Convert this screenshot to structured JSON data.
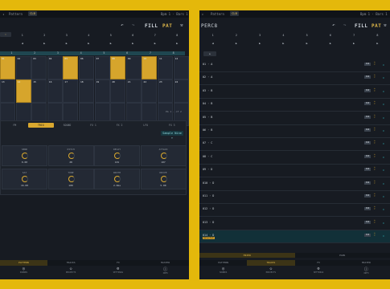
{
  "left": {
    "topbar": {
      "left_text": "Pattern",
      "chip": "CLB",
      "right_text": "Bpm 1 · Bars 1"
    },
    "header": {
      "fill": "FILL",
      "pat": "PAT",
      "undo_icon": "undo-icon",
      "redo_icon": "redo-icon",
      "wrench_icon": "wrench-icon"
    },
    "controls_row1": [
      "1",
      "2",
      "3",
      "4",
      "5",
      "6",
      "7",
      "8"
    ],
    "controls_row2": [
      "◀",
      "▶",
      "▶",
      "▶",
      "▶",
      "▶",
      "▶",
      "▶"
    ],
    "step_header": [
      "1",
      "2",
      "3",
      "4",
      "5",
      "6",
      "7",
      "8"
    ],
    "pad_labels": [
      "01",
      "02",
      "03",
      "04",
      "05",
      "06",
      "07",
      "08",
      "09",
      "10",
      "11",
      "12",
      "13",
      "14",
      "15",
      "16",
      "17",
      "18",
      "19",
      "20",
      "21",
      "22",
      "23",
      "24"
    ],
    "pads_on": [
      0,
      4,
      7,
      9,
      13
    ],
    "page_indicator": "PG 1 · of 2",
    "tabs": [
      "FM",
      "TRIG",
      "SOUND",
      "FX 1",
      "FX 2",
      "LFO",
      "FX 3"
    ],
    "active_tab": 1,
    "preset_button": "Sample Nine ▾",
    "knobs": [
      {
        "label": "SEND",
        "value": "0.00"
      },
      {
        "label": "PITCH",
        "value": "28"
      },
      {
        "label": "DECAY",
        "value": "101"
      },
      {
        "label": "ATTACK",
        "value": "107"
      },
      {
        "label": "SAT",
        "value": "16.00"
      },
      {
        "label": "TONE",
        "value": "100"
      },
      {
        "label": "WIDTH",
        "value": "2.0ms"
      },
      {
        "label": "DRIVE",
        "value": "5.00"
      }
    ],
    "bottom_tabs": [
      "PATTERN",
      "TRACKS",
      "FX",
      "MASTER"
    ],
    "bottom_active": 0,
    "nav": [
      {
        "icon": "◎",
        "label": "SOUNDS"
      },
      {
        "icon": "◇",
        "label": "PROJECTS"
      },
      {
        "icon": "⚙",
        "label": "SETTINGS"
      },
      {
        "icon": "ⓘ",
        "label": "INFO"
      }
    ]
  },
  "right": {
    "topbar": {
      "left_text": "Pattern",
      "chip": "CLB",
      "right_text": "Bpm 1 · Bars 1"
    },
    "title": "PERC8",
    "header": {
      "fill": "FILL",
      "pat": "PAT",
      "undo_icon": "undo-icon",
      "redo_icon": "redo-icon",
      "wrench_icon": "wrench-icon"
    },
    "controls_row1": [
      "1",
      "2",
      "3",
      "4",
      "5",
      "6",
      "7",
      "8"
    ],
    "controls_row2": [
      "◀",
      "▶",
      "▶",
      "▶",
      "▶",
      "▶",
      "▶",
      "▶"
    ],
    "add_button": "+",
    "tracks": [
      {
        "label": "01 · A",
        "badge": "PAN",
        "sub": ""
      },
      {
        "label": "02 · A",
        "badge": "PAN",
        "sub": ""
      },
      {
        "label": "03 · B",
        "badge": "PAN",
        "sub": ""
      },
      {
        "label": "04 · B",
        "badge": "PAN",
        "sub": ""
      },
      {
        "label": "05 · B",
        "badge": "PAN",
        "sub": ""
      },
      {
        "label": "06 · B",
        "badge": "PAN",
        "sub": ""
      },
      {
        "label": "07 · C",
        "badge": "PAN",
        "sub": ""
      },
      {
        "label": "08 · C",
        "badge": "PAN",
        "sub": ""
      },
      {
        "label": "09 · D",
        "badge": "PAN",
        "sub": ""
      },
      {
        "label": "010 · D",
        "badge": "PAN",
        "sub": ""
      },
      {
        "label": "011 · D",
        "badge": "PAN",
        "sub": ""
      },
      {
        "label": "012 · D",
        "badge": "PAN",
        "sub": ""
      },
      {
        "label": "013 · D",
        "badge": "PAN",
        "sub": ""
      },
      {
        "label": "014 · D",
        "badge": "PAN",
        "sub": "Selected"
      }
    ],
    "selected_track": 13,
    "subtabs": [
      "MIXER",
      "PANS"
    ],
    "bottom_tabs": [
      "PATTERN",
      "TRACKS",
      "FX",
      "MASTER"
    ],
    "bottom_active": 1,
    "nav": [
      {
        "icon": "◎",
        "label": "SOUNDS"
      },
      {
        "icon": "◇",
        "label": "PROJECTS"
      },
      {
        "icon": "⚙",
        "label": "SETTINGS"
      },
      {
        "icon": "ⓘ",
        "label": "INFO"
      }
    ]
  },
  "colors": {
    "background": "#e4b80b",
    "panel": "#171b22",
    "accent": "#d9a82f",
    "teal": "#2fb3b8"
  }
}
